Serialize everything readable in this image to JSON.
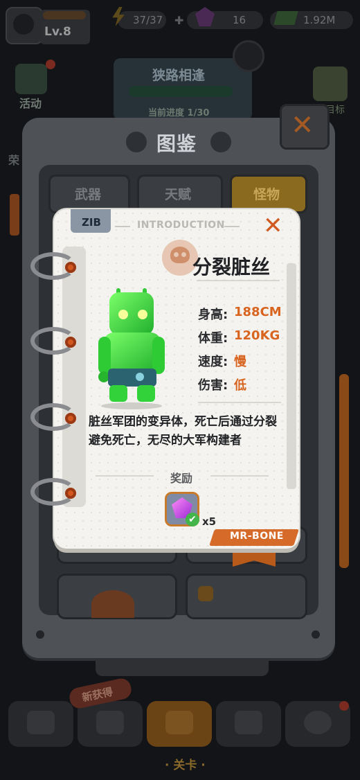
{
  "topbar": {
    "level": "Lv.8",
    "energy": "37/37",
    "gems": "16",
    "cash": "1.92M"
  },
  "background": {
    "activity_label": "活动",
    "stage_title": "狭路相逢",
    "stage_progress": "当前进度 1/30",
    "right_label": "目标",
    "left_label": "荣"
  },
  "panel": {
    "title": "图鉴",
    "tabs": [
      {
        "label": "武器",
        "active": false
      },
      {
        "label": "天赋",
        "active": false
      },
      {
        "label": "怪物",
        "active": true
      }
    ]
  },
  "card": {
    "tag": "ZIB",
    "header": "INTRODUCTION",
    "name": "分裂脏丝",
    "stats": [
      {
        "label": "身高:",
        "value": "188CM"
      },
      {
        "label": "体重:",
        "value": "120KG"
      },
      {
        "label": "速度:",
        "value": "慢"
      },
      {
        "label": "伤害:",
        "value": "低"
      }
    ],
    "description": "脏丝军团的变异体，死亡后通过分裂避免死亡，无尽的大军构建者",
    "reward_label": "奖励",
    "reward_count": "x5",
    "reward_claimed": true,
    "author": "MR-BONE"
  },
  "bottom_nav": {
    "new_badge": "新获得",
    "active_label": "· 关卡 ·"
  },
  "colors": {
    "accent_orange": "#d8641f",
    "card_bg": "#f4f3ef",
    "robot_green": "#3ddc3a"
  }
}
